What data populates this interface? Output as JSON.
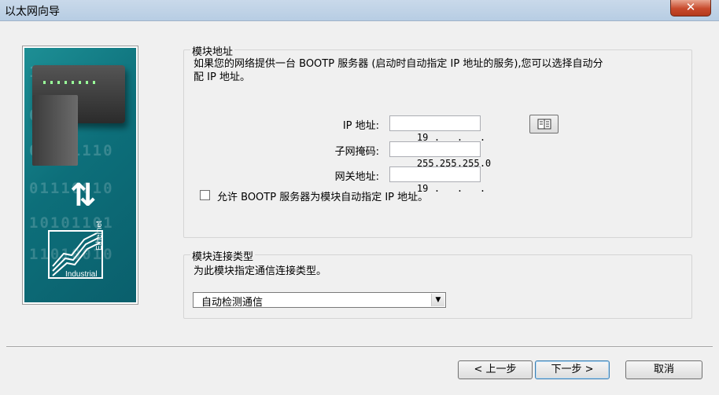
{
  "window": {
    "title": "以太网向导",
    "close_label": "✕"
  },
  "image_panel": {
    "industrial_label": "Industrial",
    "ethernet_label": "Ethernet",
    "binary_rows": [
      "10010101",
      "01000110",
      "01101110",
      "01110010",
      "10101101",
      "11010010"
    ]
  },
  "address_group": {
    "legend": "模块地址",
    "description_line1": "如果您的网络提供一台 BOOTP 服务器 (启动时自动指定 IP 地址的服务),您可以选择自动分",
    "description_line2": "配 IP 地址。",
    "ip_label": "IP 地址:",
    "ip_octets": [
      "19",
      "",
      "",
      ""
    ],
    "subnet_label": "子网掩码:",
    "subnet_octets": [
      "255",
      "255",
      "255",
      "0"
    ],
    "gateway_label": "网关地址:",
    "gateway_octets": [
      "19",
      "",
      "",
      ""
    ],
    "browse_icon": "address-book-icon",
    "bootp_checkbox_label": "允许 BOOTP 服务器为模块自动指定 IP 地址。",
    "bootp_checked": false
  },
  "connection_group": {
    "legend": "模块连接类型",
    "description": "为此模块指定通信连接类型。",
    "selected_type": "自动检测通信"
  },
  "buttons": {
    "back": "< 上一步",
    "next": "下一步 >",
    "cancel": "取消"
  }
}
